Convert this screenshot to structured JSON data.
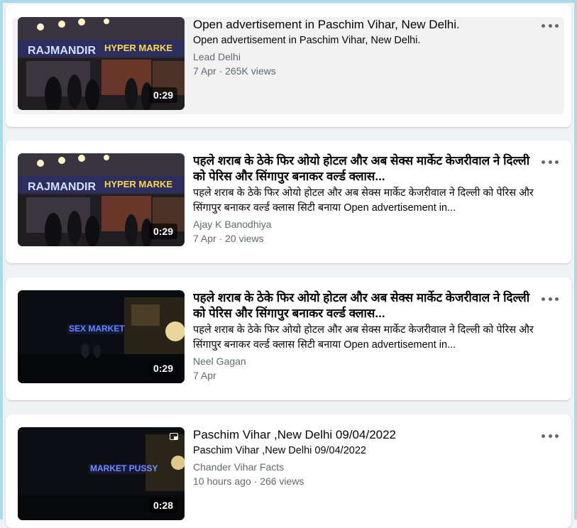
{
  "videos": [
    {
      "title": "Open advertisement in Paschim Vihar, New Delhi.",
      "description": "Open advertisement in Paschim Vihar, New Delhi.",
      "source": "Lead Delhi",
      "meta": "7 Apr · 265K views",
      "duration": "0:29",
      "thumb_text_1": "RAJMANDIR",
      "thumb_text_2": "HYPER MARKE"
    },
    {
      "title": "पहले शराब के ठेके फिर ओयो होटल और अब सेक्स मार्केट केजरीवाल ने दिल्ली को पेरिस और सिंगापुर बनाकर वर्ल्ड क्लास...",
      "description": "पहले शराब के ठेके फिर ओयो होटल और अब सेक्स मार्केट केजरीवाल ने दिल्ली को पेरिस और सिंगापुर बनाकर वर्ल्ड क्लास सिटी बनाया Open advertisement in...",
      "source": "Ajay K Banodhiya",
      "meta": "7 Apr · 20 views",
      "duration": "0:29",
      "thumb_text_1": "RAJMANDIR",
      "thumb_text_2": "HYPER MARKE"
    },
    {
      "title": "पहले शराब के ठेके फिर ओयो होटल और अब सेक्स मार्केट केजरीवाल ने दिल्ली को पेरिस और सिंगापुर बनाकर वर्ल्ड क्लास...",
      "description": "पहले शराब के ठेके फिर ओयो होटल और अब सेक्स मार्केट केजरीवाल ने दिल्ली को पेरिस और सिंगापुर बनाकर वर्ल्ड क्लास सिटी बनाया Open advertisement in...",
      "source": "Neel Gagan",
      "meta": "7 Apr",
      "duration": "0:29",
      "thumb_text_1": "SEX MARKET"
    },
    {
      "title": "Paschim Vihar ,New Delhi 09/04/2022",
      "description": "Paschim Vihar ,New Delhi 09/04/2022",
      "source": "Chander Vihar Facts",
      "meta": "10 hours ago · 266 views",
      "duration": "0:28",
      "thumb_text_1": "MARKET PUSSY"
    }
  ],
  "icons": {
    "more": "more-options-icon",
    "pip": "picture-in-picture-icon"
  },
  "colors": {
    "frame": "#a9dcea",
    "page_bg": "#f0f2f5",
    "secondary_text": "#65676b",
    "sign_blue": "#5a7bff"
  }
}
